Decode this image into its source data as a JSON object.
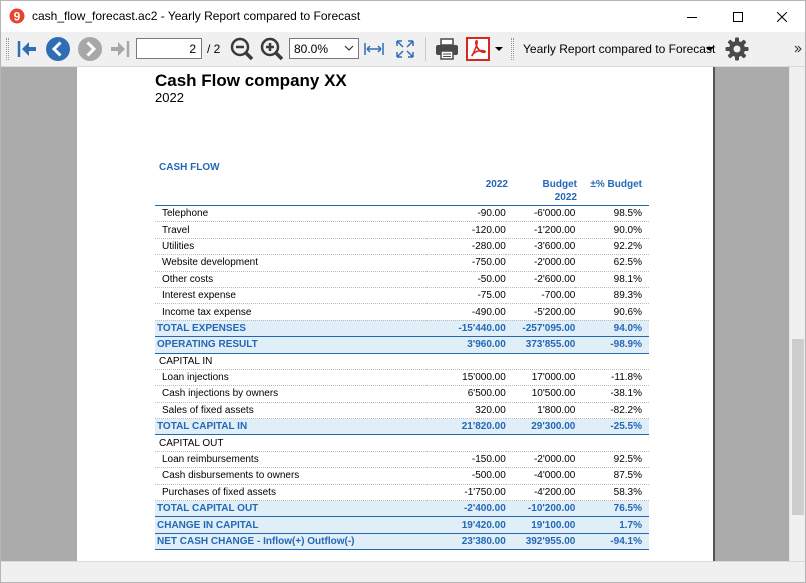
{
  "window": {
    "title": "cash_flow_forecast.ac2 - Yearly Report compared to Forecast",
    "controls": [
      "minimize-icon",
      "maximize-icon",
      "close-icon"
    ]
  },
  "toolbar": {
    "page_current": "2",
    "page_total": "/ 2",
    "zoom": "80.0%",
    "report_select": "Yearly Report compared to Forecast",
    "icons": [
      "first-page-icon",
      "previous-page-icon",
      "next-page-icon",
      "last-page-icon",
      "zoom-out-icon",
      "zoom-in-icon",
      "fit-width-icon",
      "fit-page-icon",
      "print-icon",
      "pdf-icon",
      "settings-icon"
    ],
    "colors": {
      "nav_blue": "#2f6db5",
      "nav_gray": "#a8a8a8",
      "pdf_red": "#d9261c"
    }
  },
  "report": {
    "company": "Cash Flow company XX",
    "year": "2022",
    "section_title": "CASH FLOW",
    "col_actual": "2022",
    "col_budget_line1": "Budget",
    "col_budget_line2": "2022",
    "col_diff": "±% Budget",
    "accent_color": "#2468b5",
    "total_bg": "#e0eef8",
    "rows": [
      {
        "label": "Telephone",
        "actual": "-90.00",
        "budget": "-6'000.00",
        "diff": "98.5%"
      },
      {
        "label": "Travel",
        "actual": "-120.00",
        "budget": "-1'200.00",
        "diff": "90.0%"
      },
      {
        "label": "Utilities",
        "actual": "-280.00",
        "budget": "-3'600.00",
        "diff": "92.2%"
      },
      {
        "label": "Website development",
        "actual": "-750.00",
        "budget": "-2'000.00",
        "diff": "62.5%"
      },
      {
        "label": "Other costs",
        "actual": "-50.00",
        "budget": "-2'600.00",
        "diff": "98.1%"
      },
      {
        "label": "Interest expense",
        "actual": "-75.00",
        "budget": "-700.00",
        "diff": "89.3%"
      },
      {
        "label": "Income tax expense",
        "actual": "-490.00",
        "budget": "-5'200.00",
        "diff": "90.6%"
      },
      {
        "label": "TOTAL EXPENSES",
        "actual": "-15'440.00",
        "budget": "-257'095.00",
        "diff": "94.0%"
      },
      {
        "label": "OPERATING RESULT",
        "actual": "3'960.00",
        "budget": "373'855.00",
        "diff": "-98.9%"
      },
      {
        "label": "CAPITAL IN",
        "actual": "",
        "budget": "",
        "diff": ""
      },
      {
        "label": "Loan injections",
        "actual": "15'000.00",
        "budget": "17'000.00",
        "diff": "-11.8%"
      },
      {
        "label": "Cash injections by owners",
        "actual": "6'500.00",
        "budget": "10'500.00",
        "diff": "-38.1%"
      },
      {
        "label": "Sales of fixed assets",
        "actual": "320.00",
        "budget": "1'800.00",
        "diff": "-82.2%"
      },
      {
        "label": "TOTAL CAPITAL IN",
        "actual": "21'820.00",
        "budget": "29'300.00",
        "diff": "-25.5%"
      },
      {
        "label": "CAPITAL OUT",
        "actual": "",
        "budget": "",
        "diff": ""
      },
      {
        "label": "Loan reimbursements",
        "actual": "-150.00",
        "budget": "-2'000.00",
        "diff": "92.5%"
      },
      {
        "label": "Cash disbursements to owners",
        "actual": "-500.00",
        "budget": "-4'000.00",
        "diff": "87.5%"
      },
      {
        "label": "Purchases of fixed assets",
        "actual": "-1'750.00",
        "budget": "-4'200.00",
        "diff": "58.3%"
      },
      {
        "label": "TOTAL CAPITAL OUT",
        "actual": "-2'400.00",
        "budget": "-10'200.00",
        "diff": "76.5%"
      },
      {
        "label": "CHANGE IN CAPITAL",
        "actual": "19'420.00",
        "budget": "19'100.00",
        "diff": "1.7%"
      },
      {
        "label": "NET CASH CHANGE -  Inflow(+) Outflow(-)",
        "actual": "23'380.00",
        "budget": "392'955.00",
        "diff": "-94.1%"
      }
    ]
  }
}
